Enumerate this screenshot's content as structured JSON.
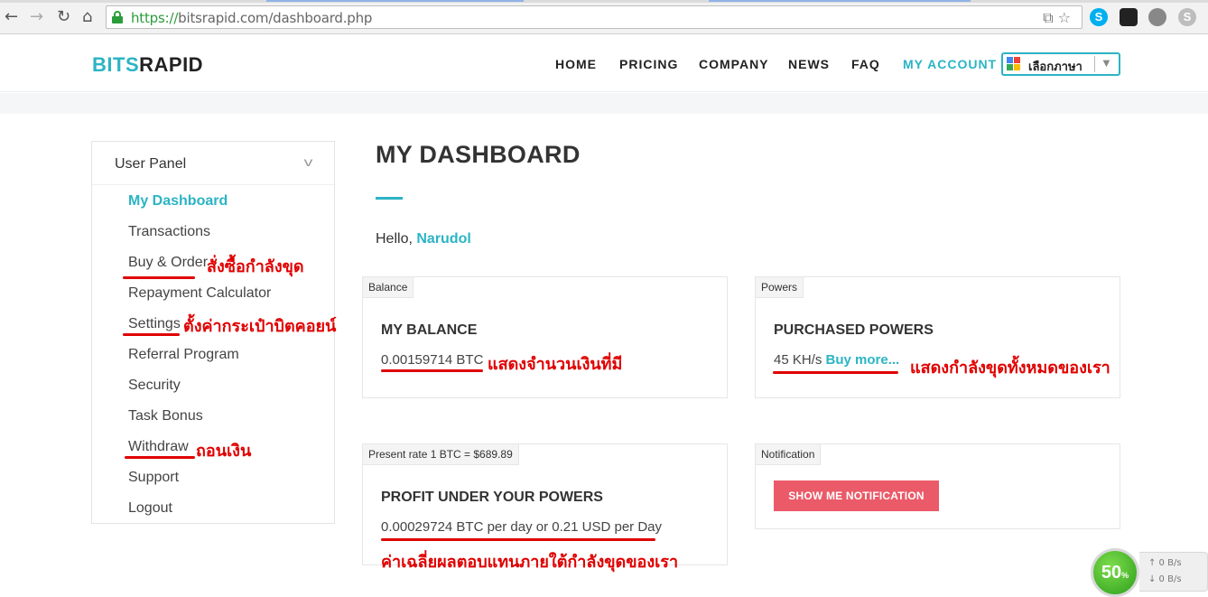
{
  "browser": {
    "back_icon": "←",
    "forward_icon": "→",
    "reload_icon": "↻",
    "home_icon": "⌂",
    "url_scheme": "https://",
    "url_rest": "bitsrapid.com/dashboard.php",
    "url_actions": "⧉ ☆"
  },
  "header": {
    "logo_bits": "BITS",
    "logo_rapid": "RAPID",
    "nav": [
      "HOME",
      "PRICING",
      "COMPANY",
      "NEWS",
      "FAQ",
      "MY ACCOUNT"
    ],
    "language_select": "เลือกภาษา",
    "language_arrow": "▼"
  },
  "sidebar": {
    "title": "User Panel",
    "chevron": "v",
    "items": [
      "My Dashboard",
      "Transactions",
      "Buy & Order",
      "Repayment Calculator",
      "Settings",
      "Referral Program",
      "Security",
      "Task Bonus",
      "Withdraw",
      "Support",
      "Logout"
    ]
  },
  "main": {
    "title": "MY DASHBOARD",
    "hello_prefix": "Hello, ",
    "user_name": "Narudol",
    "balance": {
      "tag": "Balance",
      "title": "MY BALANCE",
      "value": "0.00159714 BTC"
    },
    "powers": {
      "tag": "Powers",
      "title": "PURCHASED POWERS",
      "value": "45 KH/s",
      "link": "Buy more..."
    },
    "profit": {
      "tag": "Present rate 1 BTC = $689.89",
      "title": "PROFIT UNDER YOUR POWERS",
      "value": "0.00029724 BTC per day or 0.21 USD per Day"
    },
    "notification": {
      "tag": "Notification",
      "button": "SHOW ME NOTIFICATION"
    }
  },
  "annotations": {
    "buy_order": "สั่งซื้อกำลังขุด",
    "settings": "ตั้งค่ากระเป๋าบิตคอยน์",
    "withdraw": "ถอนเงิน",
    "balance": "แสดงจำนวนเงินที่มี",
    "powers": "แสดงกำลังขุดทั้งหมดของเรา",
    "profit": "ค่าเฉลี่ยผลตอบแทนภายใต้กำลังขุดของเรา"
  },
  "network_widget": {
    "percent": "50",
    "percent_sign": "%",
    "upload": "↑ 0 B/s",
    "download": "↓ 0 B/s"
  },
  "colors": {
    "accent": "#2bb4c4",
    "annotation": "#e00000",
    "notify_button": "#eb5a68"
  }
}
